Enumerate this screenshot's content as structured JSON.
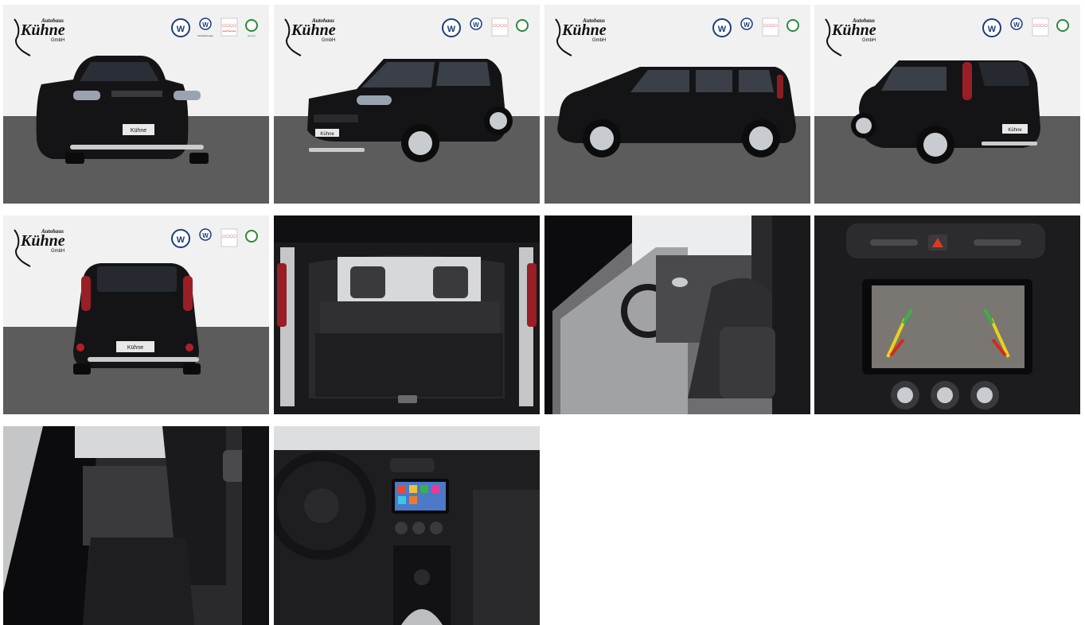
{
  "gallery": {
    "dealer": {
      "logo_main": "Kühne",
      "logo_top": "Autohaus",
      "logo_sub": "GmbH",
      "badge_vw_label": "Nutzfahrzeuge",
      "badge_audi_label": "Audi Service",
      "badge_skoda_label": "Service"
    },
    "colors": {
      "studio_wall": "#f1f1f1",
      "studio_floor": "#5c5c5c",
      "car_body": "#141416",
      "interior": "#2a2a2c"
    },
    "thumbnails": [
      {
        "view": "exterior-front",
        "plate": "Kühne"
      },
      {
        "view": "exterior-front-three-quarter",
        "plate": "Kühne"
      },
      {
        "view": "exterior-side"
      },
      {
        "view": "exterior-rear-three-quarter",
        "plate": "Kühne"
      },
      {
        "view": "exterior-rear",
        "plate": "Kühne"
      },
      {
        "view": "trunk-open"
      },
      {
        "view": "front-seats"
      },
      {
        "view": "rear-camera-display"
      },
      {
        "view": "rear-seats"
      },
      {
        "view": "dashboard-cockpit"
      }
    ]
  }
}
